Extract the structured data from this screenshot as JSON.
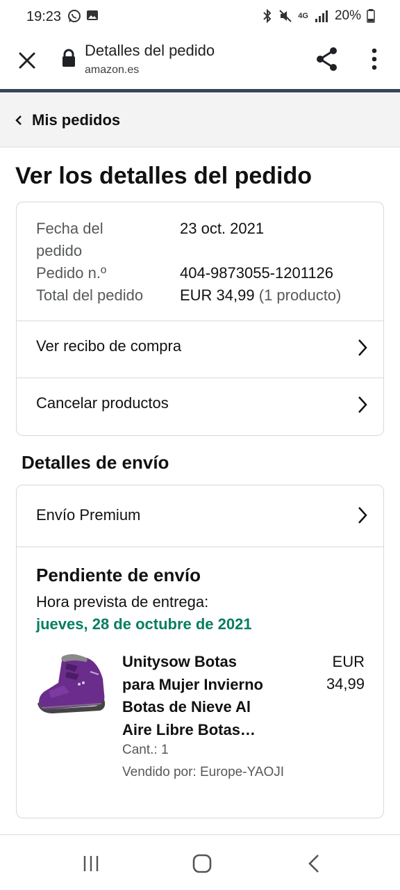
{
  "status_bar": {
    "time": "19:23",
    "battery": "20%",
    "network": "4G",
    "icons": [
      "whatsapp-icon",
      "gallery-icon",
      "bluetooth-icon",
      "mute-icon",
      "signal-icon",
      "battery-icon"
    ]
  },
  "browser": {
    "title": "Detalles del pedido",
    "url": "amazon.es",
    "icons": [
      "close-icon",
      "lock-icon",
      "share-icon",
      "more-vert-icon"
    ]
  },
  "breadcrumb": {
    "label": "Mis pedidos"
  },
  "page": {
    "title": "Ver los detalles del pedido"
  },
  "order": {
    "date_label_1": "Fecha del",
    "date_label_2": "pedido",
    "date_value": "23 oct. 2021",
    "number_label": "Pedido n.º",
    "number_value": "404-9873055-1201126",
    "total_label": "Total del pedido",
    "total_value": "EUR 34,99",
    "total_count": "(1 producto)",
    "links": [
      {
        "label": "Ver recibo de compra"
      },
      {
        "label": "Cancelar productos"
      }
    ]
  },
  "shipping": {
    "section_title": "Detalles de envío",
    "method": "Envío Premium",
    "status": "Pendiente de envío",
    "eta_label": "Hora prevista de entrega:",
    "eta_date": "jueves, 28 de octubre de 2021",
    "eta_color": "#067d62",
    "product": {
      "name_lines": [
        "Unitysow Botas",
        "para Mujer Invierno",
        "Botas de Nieve Al",
        "Aire Libre Botas…"
      ],
      "price_currency": "EUR",
      "price_amount": "34,99",
      "quantity": "Cant.: 1",
      "seller": "Vendido por: Europe-YAOJI"
    }
  },
  "nav_bar": {
    "icons": [
      "recent-apps-icon",
      "home-icon",
      "back-icon"
    ]
  }
}
